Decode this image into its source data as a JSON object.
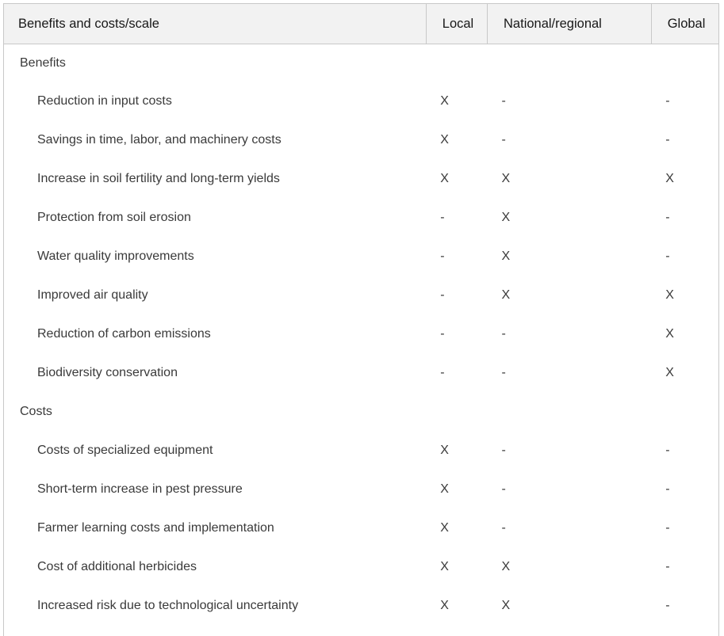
{
  "table": {
    "columns": [
      {
        "key": "label",
        "label": "Benefits and costs/scale"
      },
      {
        "key": "local",
        "label": "Local"
      },
      {
        "key": "national",
        "label": "National/regional"
      },
      {
        "key": "global",
        "label": "Global"
      }
    ],
    "mark_present": "X",
    "mark_absent": "-",
    "rows": [
      {
        "type": "section",
        "label": "Benefits",
        "local": "",
        "national": "",
        "global": ""
      },
      {
        "type": "item",
        "label": "Reduction in input costs",
        "local": "X",
        "national": "-",
        "global": "-"
      },
      {
        "type": "item",
        "label": "Savings in time, labor, and machinery costs",
        "local": "X",
        "national": "-",
        "global": "-"
      },
      {
        "type": "item",
        "label": "Increase in soil fertility and long-term yields",
        "local": "X",
        "national": "X",
        "global": "X"
      },
      {
        "type": "item",
        "label": "Protection from soil erosion",
        "local": "-",
        "national": "X",
        "global": "-"
      },
      {
        "type": "item",
        "label": "Water quality improvements",
        "local": "-",
        "national": "X",
        "global": "-"
      },
      {
        "type": "item",
        "label": "Improved air quality",
        "local": "-",
        "national": "X",
        "global": "X"
      },
      {
        "type": "item",
        "label": "Reduction of carbon emissions",
        "local": "-",
        "national": "-",
        "global": "X"
      },
      {
        "type": "item",
        "label": "Biodiversity conservation",
        "local": "-",
        "national": "-",
        "global": "X"
      },
      {
        "type": "section",
        "label": "Costs",
        "local": "",
        "national": "",
        "global": ""
      },
      {
        "type": "item",
        "label": "Costs of specialized equipment",
        "local": "X",
        "national": "-",
        "global": "-"
      },
      {
        "type": "item",
        "label": "Short-term increase in pest pressure",
        "local": "X",
        "national": "-",
        "global": "-"
      },
      {
        "type": "item",
        "label": "Farmer learning costs and implementation",
        "local": "X",
        "national": "-",
        "global": "-"
      },
      {
        "type": "item",
        "label": "Cost of additional herbicides",
        "local": "X",
        "national": "X",
        "global": "-"
      },
      {
        "type": "item",
        "label": "Increased risk due to technological uncertainty",
        "local": "X",
        "national": "X",
        "global": "-"
      }
    ]
  },
  "colors": {
    "header_background": "#f2f2f2",
    "border": "#c8c8c8",
    "header_text": "#181818",
    "body_text": "#3a3a3a",
    "page_background": "#ffffff"
  }
}
